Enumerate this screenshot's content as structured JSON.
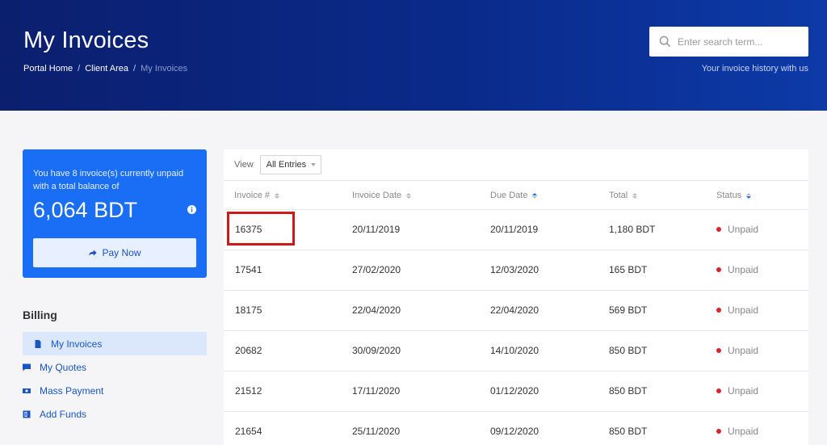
{
  "header": {
    "title": "My Invoices",
    "breadcrumb": [
      "Portal Home",
      "Client Area",
      "My Invoices"
    ],
    "breadcrumb_sep": "/",
    "search_placeholder": "Enter search term...",
    "tagline": "Your invoice history with us"
  },
  "balance": {
    "text": "You have 8 invoice(s) currently unpaid with a total balance of",
    "amount": "6,064 BDT",
    "pay_label": "Pay Now"
  },
  "billing": {
    "heading": "Billing",
    "items": [
      {
        "label": "My Invoices",
        "icon": "document-icon",
        "active": true
      },
      {
        "label": "My Quotes",
        "icon": "chat-icon",
        "active": false
      },
      {
        "label": "Mass Payment",
        "icon": "money-icon",
        "active": false
      },
      {
        "label": "Add Funds",
        "icon": "add-funds-icon",
        "active": false
      }
    ]
  },
  "table": {
    "view_label": "View",
    "view_value": "All Entries",
    "columns": [
      "Invoice #",
      "Invoice Date",
      "Due Date",
      "Total",
      "Status"
    ],
    "rows": [
      {
        "id": "16375",
        "invoice_date": "20/11/2019",
        "due_date": "20/11/2019",
        "total": "1,180 BDT",
        "status": "Unpaid"
      },
      {
        "id": "17541",
        "invoice_date": "27/02/2020",
        "due_date": "12/03/2020",
        "total": "165 BDT",
        "status": "Unpaid"
      },
      {
        "id": "18175",
        "invoice_date": "22/04/2020",
        "due_date": "22/04/2020",
        "total": "569 BDT",
        "status": "Unpaid"
      },
      {
        "id": "20682",
        "invoice_date": "30/09/2020",
        "due_date": "14/10/2020",
        "total": "850 BDT",
        "status": "Unpaid"
      },
      {
        "id": "21512",
        "invoice_date": "17/11/2020",
        "due_date": "01/12/2020",
        "total": "850 BDT",
        "status": "Unpaid"
      },
      {
        "id": "21654",
        "invoice_date": "25/11/2020",
        "due_date": "09/12/2020",
        "total": "850 BDT",
        "status": "Unpaid"
      }
    ]
  },
  "colors": {
    "header_dark": "#0b1f6e",
    "header_light": "#0d3aa8",
    "accent": "#1a6ef5",
    "link": "#1a55c4",
    "unpaid": "#d9232d",
    "highlight": "#cc1a1a"
  }
}
